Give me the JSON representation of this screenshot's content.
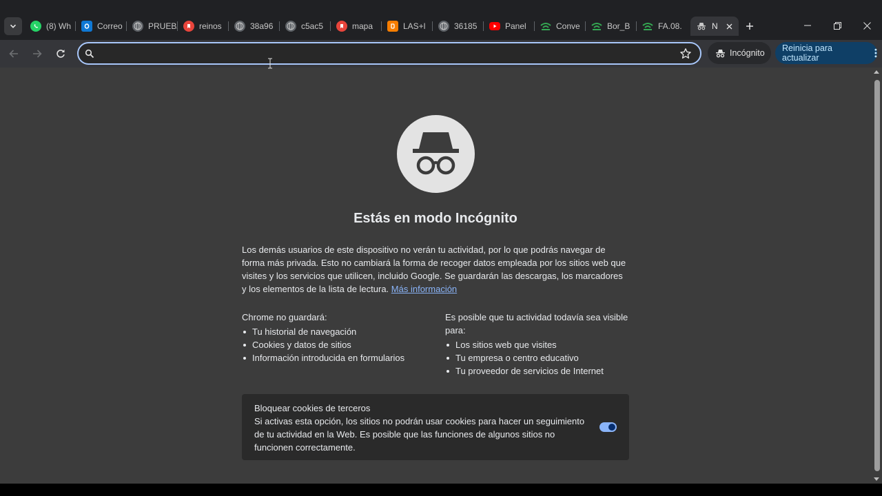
{
  "tabs": [
    {
      "title": "(8) Wh",
      "icon": "whatsapp-icon",
      "color": "#25d366"
    },
    {
      "title": "Correo",
      "icon": "outlook-icon",
      "color": "#0f78d4"
    },
    {
      "title": "PRUEBA",
      "icon": "globe-icon",
      "color": "#9aa0a6"
    },
    {
      "title": "reinos",
      "icon": "bookmark-site-icon",
      "color": "#e8453c"
    },
    {
      "title": "38a96",
      "icon": "globe-icon",
      "color": "#9aa0a6"
    },
    {
      "title": "c5ac5",
      "icon": "globe-icon",
      "color": "#9aa0a6"
    },
    {
      "title": "mapa",
      "icon": "bookmark-site-icon",
      "color": "#e8453c"
    },
    {
      "title": "LAS+l",
      "icon": "blogger-icon",
      "color": "#f57d00"
    },
    {
      "title": "36185",
      "icon": "globe-icon",
      "color": "#9aa0a6"
    },
    {
      "title": "Panel",
      "icon": "youtube-icon",
      "color": "#ff0000"
    },
    {
      "title": "Conve",
      "icon": "network-icon",
      "color": "#34a853"
    },
    {
      "title": "Bor_B",
      "icon": "network-icon",
      "color": "#34a853"
    },
    {
      "title": "FA.08.",
      "icon": "network-icon",
      "color": "#34a853"
    }
  ],
  "active_tab": {
    "title": "N",
    "icon": "incognito-icon"
  },
  "toolbar": {
    "omnibox_value": "",
    "incognito_label": "Incógnito",
    "update_label": "Reinicia para actualizar"
  },
  "page": {
    "title": "Estás en modo Incógnito",
    "intro": "Los demás usuarios de este dispositivo no verán tu actividad, por lo que podrás navegar de forma más privada. Esto no cambiará la forma de recoger datos empleada por los sitios web que visites y los servicios que utilicen, incluido Google. Se guardarán las descargas, los marcadores y los elementos de la lista de lectura.",
    "learn_more": "Más información",
    "not_saved_heading": "Chrome no guardará:",
    "not_saved_items": [
      "Tu historial de navegación",
      "Cookies y datos de sitios",
      "Información introducida en formularios"
    ],
    "visible_heading": "Es posible que tu actividad todavía sea visible para:",
    "visible_items": [
      "Los sitios web que visites",
      "Tu empresa o centro educativo",
      "Tu proveedor de servicios de Internet"
    ],
    "cookie_title": "Bloquear cookies de terceros",
    "cookie_desc": "Si activas esta opción, los sitios no podrán usar cookies para hacer un seguimiento de tu actividad en la Web. Es posible que las funciones de algunos sitios no funcionen correctamente.",
    "cookie_toggle_on": true
  },
  "colors": {
    "accent": "#8ab4f8",
    "omnibox_border": "#a8c7fa",
    "update_bg": "#0f3f66",
    "content_bg": "#3c3c3c"
  }
}
